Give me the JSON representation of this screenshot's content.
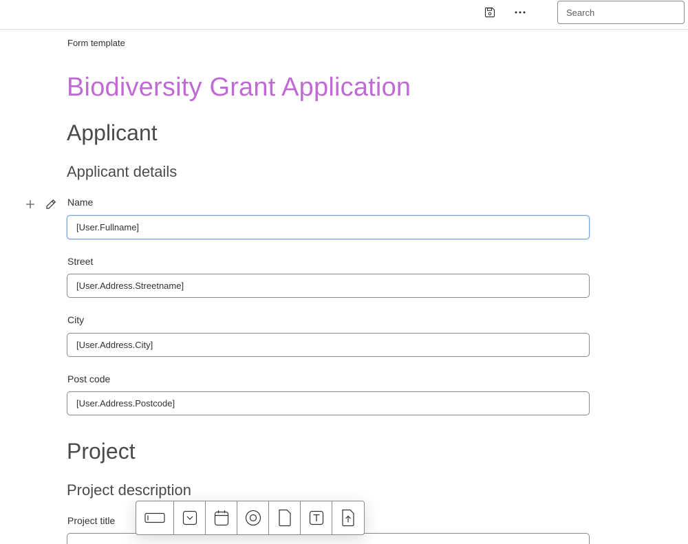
{
  "topbar": {
    "save_icon": "save-icon",
    "more_icon": "more-options-icon",
    "search": {
      "placeholder": "Search",
      "value": ""
    }
  },
  "breadcrumb": "Form template",
  "form_title": "Biodiversity Grant Application",
  "sections": {
    "applicant": {
      "heading": "Applicant",
      "subheading": "Applicant details",
      "fields": {
        "name": {
          "label": "Name",
          "value": "[User.Fullname]"
        },
        "street": {
          "label": "Street",
          "value": "[User.Address.Streetname]"
        },
        "city": {
          "label": "City",
          "value": "[User.Address.City]"
        },
        "postcode": {
          "label": "Post code",
          "value": "[User.Address.Postcode]"
        }
      }
    },
    "project": {
      "heading": "Project",
      "subheading": "Project description",
      "fields": {
        "title": {
          "label": "Project title",
          "value": ""
        }
      }
    }
  },
  "gutter": {
    "add_icon": "plus-icon",
    "edit_icon": "pencil-icon"
  },
  "toolbox": {
    "tools": [
      "text-field-icon",
      "dropdown-icon",
      "date-picker-icon",
      "radio-button-icon",
      "document-icon",
      "text-block-icon",
      "file-upload-icon"
    ]
  },
  "colors": {
    "title": "#c06bd4",
    "focus_border": "#7aa7e0",
    "border": "#8a8886"
  }
}
